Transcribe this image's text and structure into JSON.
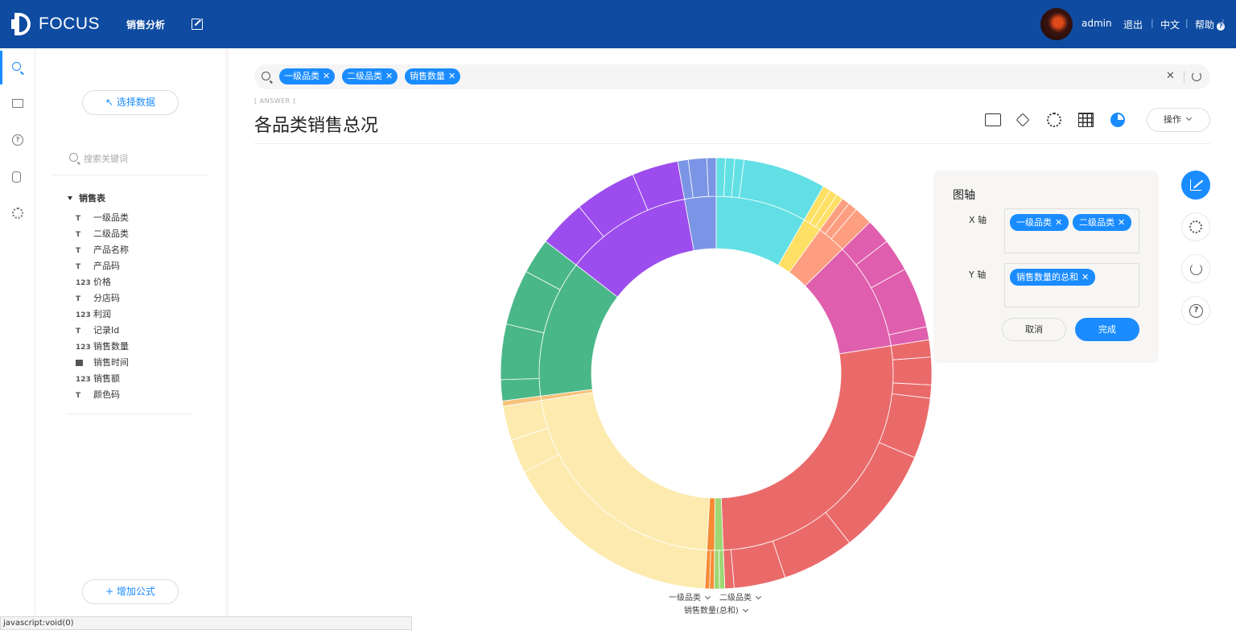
{
  "header": {
    "logo_text": "FOCUS",
    "nav_item": "销售分析",
    "user": "admin",
    "logout": "退出",
    "language": "中文",
    "help": "帮助"
  },
  "sidebar": {
    "select_data": "↖ 选择数据",
    "search_placeholder": "搜索关键词",
    "table_name": "销售表",
    "fields": [
      {
        "type": "text",
        "label": "一级品类"
      },
      {
        "type": "text",
        "label": "二级品类"
      },
      {
        "type": "text",
        "label": "产品名称"
      },
      {
        "type": "text",
        "label": "产品码"
      },
      {
        "type": "number",
        "label": "价格"
      },
      {
        "type": "text",
        "label": "分店码"
      },
      {
        "type": "number",
        "label": "利润"
      },
      {
        "type": "text",
        "label": "记录Id"
      },
      {
        "type": "number",
        "label": "销售数量"
      },
      {
        "type": "date",
        "label": "销售时间"
      },
      {
        "type": "number",
        "label": "销售额"
      },
      {
        "type": "text",
        "label": "颜色码"
      }
    ],
    "type_glyphs": {
      "text": "T",
      "number": "123"
    },
    "add_formula": "+ 增加公式"
  },
  "search": {
    "tokens": [
      "一级品类",
      "二级品类",
      "销售数量"
    ]
  },
  "answer": {
    "tag": "[ ANSWER ]",
    "title": "各品类销售总况",
    "ops_label": "操作"
  },
  "axis_panel": {
    "title": "图轴",
    "x_label": "X 轴",
    "y_label": "Y 轴",
    "x_chips": [
      "一级品类",
      "二级品类"
    ],
    "y_chips": [
      "销售数量的总和"
    ],
    "cancel": "取消",
    "done": "完成"
  },
  "chart_controls": {
    "dim1": "一级品类",
    "dim2": "二级品类",
    "measure": "销售数量(总和)"
  },
  "chart_data": {
    "type": "sunburst",
    "inner": [
      {
        "color": "#62dfe4",
        "value": 8.4
      },
      {
        "color": "#fde064",
        "value": 1.7
      },
      {
        "color": "#fd9e80",
        "value": 2.7
      },
      {
        "color": "#df5ead",
        "value": 10.0
      },
      {
        "color": "#ea6a6a",
        "value": 27.2
      },
      {
        "color": "#9ed774",
        "value": 0.8
      },
      {
        "color": "#f78b33",
        "value": 0.7
      },
      {
        "color": "#fdeaae",
        "value": 22.0
      },
      {
        "color": "#f6c27a",
        "value": 0.4
      },
      {
        "color": "#4ab788",
        "value": 12.7
      },
      {
        "color": "#9d4ded",
        "value": 11.8
      },
      {
        "color": "#7b95e6",
        "value": 2.9
      }
    ],
    "outer": [
      {
        "color": "#62dfe4",
        "value": 0.7
      },
      {
        "color": "#62dfe4",
        "value": 0.7
      },
      {
        "color": "#62dfe4",
        "value": 0.7
      },
      {
        "color": "#62dfe4",
        "value": 6.3
      },
      {
        "color": "#fde064",
        "value": 0.6
      },
      {
        "color": "#fde064",
        "value": 0.6
      },
      {
        "color": "#fde064",
        "value": 0.5
      },
      {
        "color": "#fd9e80",
        "value": 0.6
      },
      {
        "color": "#fd9e80",
        "value": 0.7
      },
      {
        "color": "#fd9e80",
        "value": 1.4
      },
      {
        "color": "#df5ead",
        "value": 1.9
      },
      {
        "color": "#df5ead",
        "value": 2.5
      },
      {
        "color": "#df5ead",
        "value": 4.6
      },
      {
        "color": "#df5ead",
        "value": 1.0
      },
      {
        "color": "#ea6a6a",
        "value": 1.3
      },
      {
        "color": "#ea6a6a",
        "value": 2.1
      },
      {
        "color": "#ea6a6a",
        "value": 1.0
      },
      {
        "color": "#ea6a6a",
        "value": 4.6
      },
      {
        "color": "#ea6a6a",
        "value": 8.1
      },
      {
        "color": "#ea6a6a",
        "value": 5.5
      },
      {
        "color": "#ea6a6a",
        "value": 3.9
      },
      {
        "color": "#ea6a6a",
        "value": 0.7
      },
      {
        "color": "#9ed774",
        "value": 0.4
      },
      {
        "color": "#9ed774",
        "value": 0.4
      },
      {
        "color": "#f78b33",
        "value": 0.35
      },
      {
        "color": "#f78b33",
        "value": 0.35
      },
      {
        "color": "#fdeaae",
        "value": 16.8
      },
      {
        "color": "#fdeaae",
        "value": 2.6
      },
      {
        "color": "#fdeaae",
        "value": 2.6
      },
      {
        "color": "#f6c27a",
        "value": 0.4
      },
      {
        "color": "#4ab788",
        "value": 1.6
      },
      {
        "color": "#4ab788",
        "value": 4.2
      },
      {
        "color": "#4ab788",
        "value": 4.2
      },
      {
        "color": "#4ab788",
        "value": 2.7
      },
      {
        "color": "#9d4ded",
        "value": 3.6
      },
      {
        "color": "#9d4ded",
        "value": 4.7
      },
      {
        "color": "#9d4ded",
        "value": 3.5
      },
      {
        "color": "#7b95e6",
        "value": 0.8
      },
      {
        "color": "#7b95e6",
        "value": 1.4
      },
      {
        "color": "#7b95e6",
        "value": 0.7
      }
    ]
  },
  "status_bar": "javascript:void(0)"
}
